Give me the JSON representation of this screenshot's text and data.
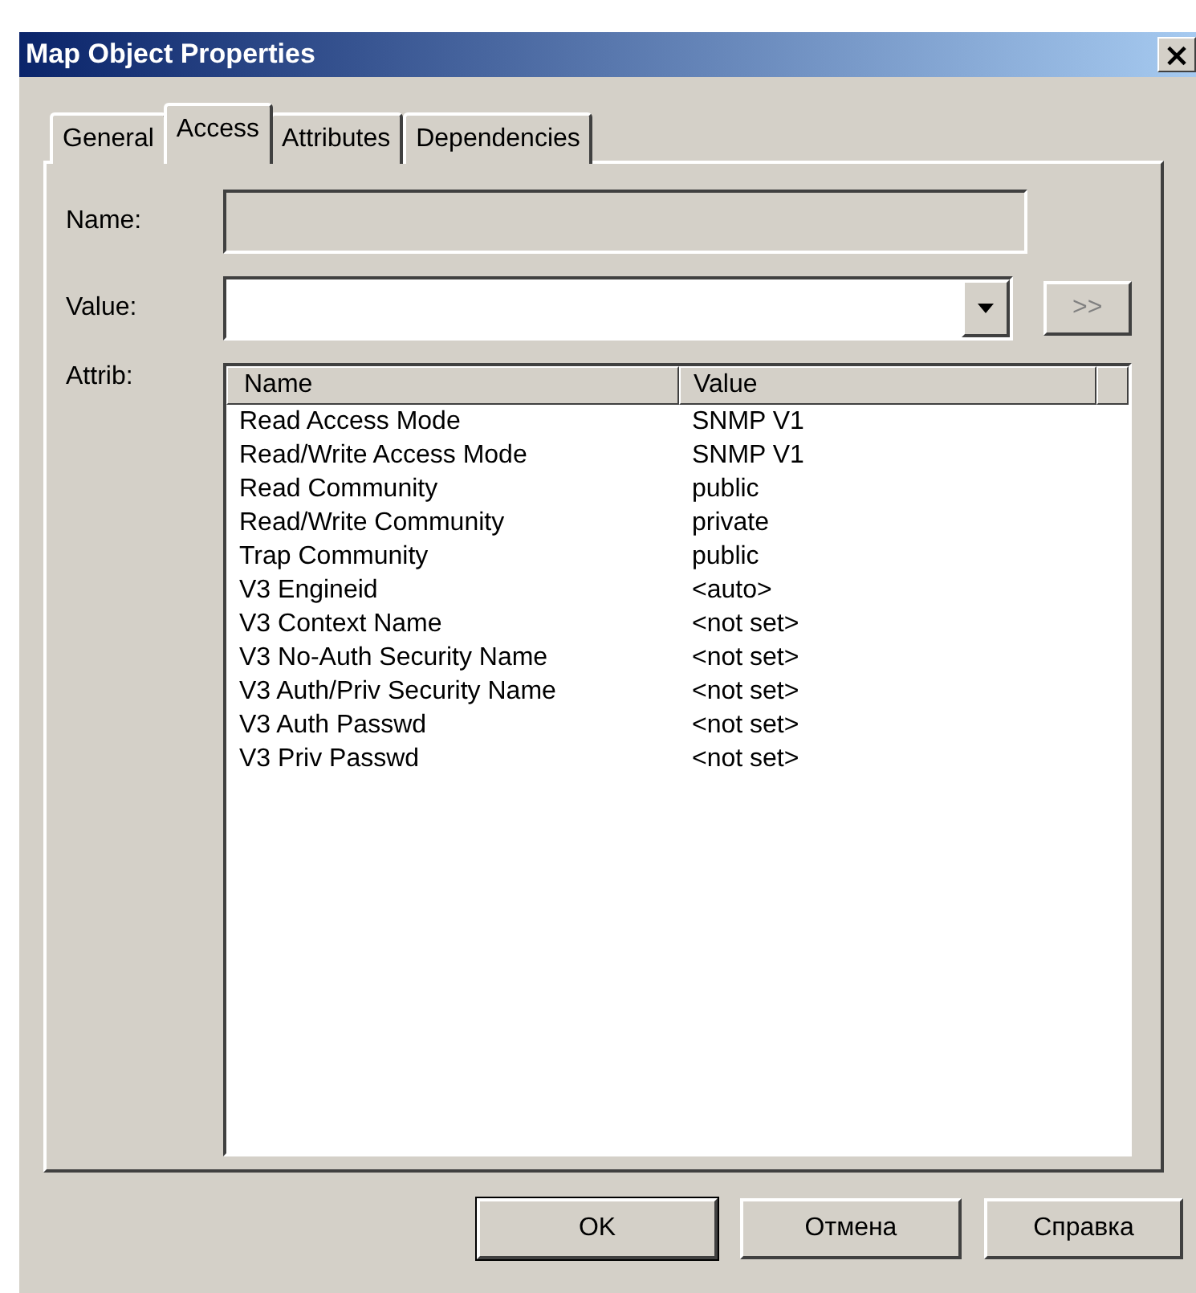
{
  "window": {
    "title": "Map Object Properties",
    "close": "×"
  },
  "tabs": [
    {
      "label": "General",
      "selected": false
    },
    {
      "label": "Access",
      "selected": true
    },
    {
      "label": "Attributes",
      "selected": false
    },
    {
      "label": "Dependencies",
      "selected": false
    }
  ],
  "name_field": {
    "label": "Name:",
    "disabled": true
  },
  "value_field": {
    "label": "Value:",
    "more_button": ">>",
    "more_disabled": true
  },
  "attrib": {
    "label": "Attrib:",
    "columns": [
      "Name",
      "Value"
    ],
    "rows": [
      {
        "name": "Read Access Mode",
        "value": "SNMP V1"
      },
      {
        "name": "Read/Write Access Mode",
        "value": "SNMP V1"
      },
      {
        "name": "Read Community",
        "value": "public"
      },
      {
        "name": "Read/Write Community",
        "value": "private"
      },
      {
        "name": "Trap Community",
        "value": "public"
      },
      {
        "name": "V3 Engineid",
        "value": "<auto>"
      },
      {
        "name": "V3 Context Name",
        "value": "<not set>"
      },
      {
        "name": "V3 No-Auth Security Name",
        "value": "<not set>"
      },
      {
        "name": "V3 Auth/Priv Security Name",
        "value": "<not set>"
      },
      {
        "name": "V3 Auth Passwd",
        "value": "<not set>"
      },
      {
        "name": "V3 Priv Passwd",
        "value": "<not set>"
      }
    ]
  },
  "buttons": [
    {
      "label": "OK",
      "default": true
    },
    {
      "label": "Отмена",
      "default": false
    },
    {
      "label": "Справка",
      "default": false
    }
  ]
}
